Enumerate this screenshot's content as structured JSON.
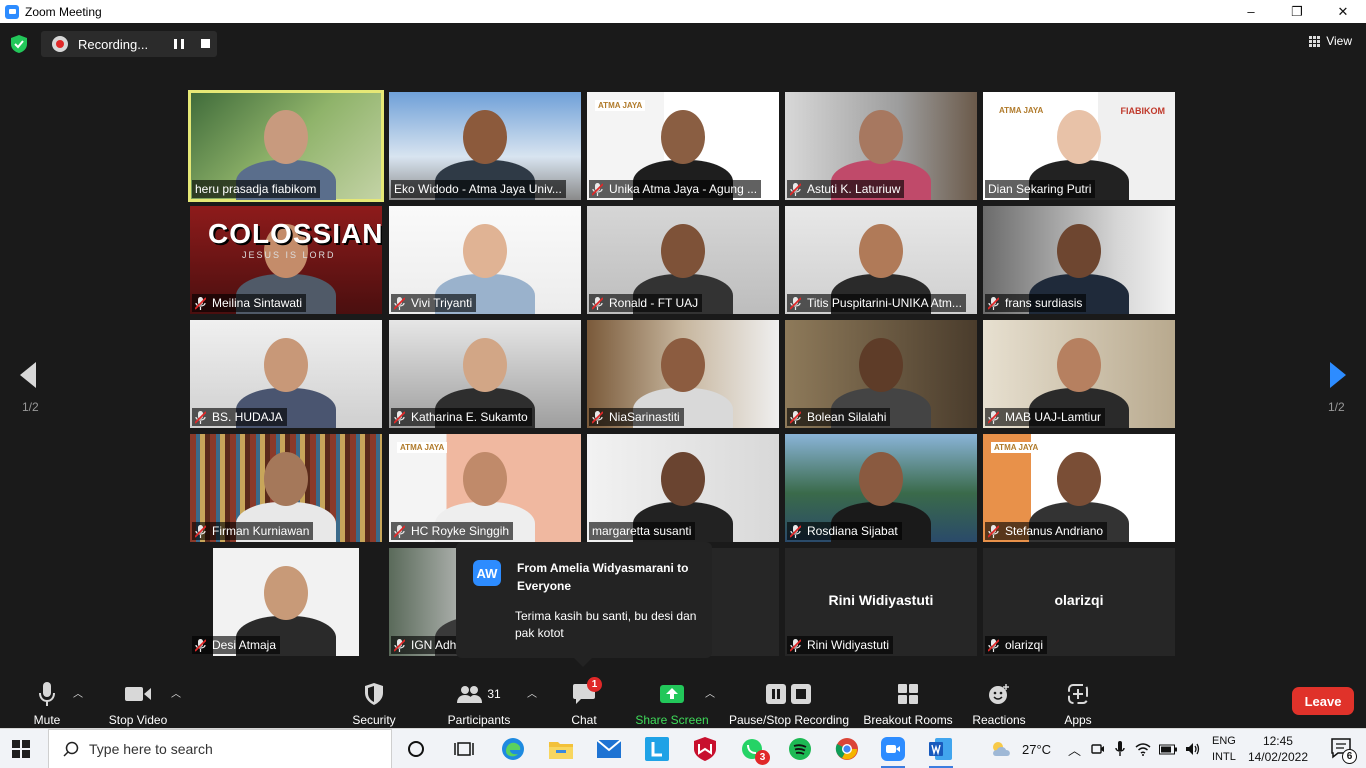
{
  "window": {
    "title": "Zoom Meeting",
    "minimize": "–",
    "maximize": "❐",
    "close": "✕"
  },
  "recording": {
    "label": "Recording..."
  },
  "view": {
    "label": "View"
  },
  "pages": {
    "left": "1/2",
    "right": "1/2"
  },
  "participants": [
    {
      "name": "heru prasadja fiabikom",
      "muted": false,
      "active": true
    },
    {
      "name": "Eko Widodo - Atma Jaya Univ...",
      "muted": false,
      "active": false
    },
    {
      "name": "Unika Atma Jaya - Agung ...",
      "muted": true,
      "active": false
    },
    {
      "name": "Astuti K. Laturiuw",
      "muted": true,
      "active": false
    },
    {
      "name": "Dian Sekaring Putri",
      "muted": false,
      "active": false
    },
    {
      "name": "Meilina Sintawati",
      "muted": true,
      "active": false
    },
    {
      "name": "Vivi Triyanti",
      "muted": true,
      "active": false
    },
    {
      "name": "Ronald - FT UAJ",
      "muted": true,
      "active": false
    },
    {
      "name": "Titis Puspitarini-UNIKA Atm...",
      "muted": true,
      "active": false
    },
    {
      "name": "frans surdiasis",
      "muted": true,
      "active": false
    },
    {
      "name": "BS. HUDAJA",
      "muted": true,
      "active": false
    },
    {
      "name": "Katharina E. Sukamto",
      "muted": true,
      "active": false
    },
    {
      "name": "NiaSarinastiti",
      "muted": true,
      "active": false
    },
    {
      "name": "Bolean Silalahi",
      "muted": true,
      "active": false
    },
    {
      "name": "MAB UAJ-Lamtiur",
      "muted": true,
      "active": false
    },
    {
      "name": "Firman Kurniawan",
      "muted": true,
      "active": false
    },
    {
      "name": "HC Royke Singgih",
      "muted": true,
      "active": false
    },
    {
      "name": "margaretta susanti",
      "muted": false,
      "active": false
    },
    {
      "name": "Rosdiana Sijabat",
      "muted": true,
      "active": false
    },
    {
      "name": "Stefanus Andriano",
      "muted": true,
      "active": false
    },
    {
      "name": "Desi Atmaja",
      "muted": true,
      "active": false
    },
    {
      "name": "IGN Adh",
      "muted": true,
      "active": false
    },
    {
      "name": "",
      "muted": false,
      "active": false
    },
    {
      "name": "Rini Widiyastuti",
      "muted": true,
      "active": false,
      "center": "Rini Widiyastuti"
    },
    {
      "name": "olarizqi",
      "muted": true,
      "active": false,
      "center": "olarizqi"
    }
  ],
  "slide_texts": {
    "coloss": "COLOSSIANS",
    "coloss_sub": "JESUS IS LORD",
    "atma": "ATMA JAYA",
    "fiabikom": "FIABIKOM"
  },
  "chat_popup": {
    "initials": "AW",
    "from": "From Amelia Widyasmarani to Everyone",
    "message": "Terima kasih bu santi, bu desi dan pak kotot"
  },
  "toolbar": {
    "mute": "Mute",
    "stop_video": "Stop Video",
    "security": "Security",
    "participants": "Participants",
    "participants_count": "31",
    "chat": "Chat",
    "chat_badge": "1",
    "share_screen": "Share Screen",
    "pause_stop_recording": "Pause/Stop Recording",
    "breakout_rooms": "Breakout Rooms",
    "reactions": "Reactions",
    "apps": "Apps",
    "leave": "Leave"
  },
  "taskbar": {
    "search_placeholder": "Type here to search",
    "whatsapp_badge": "3",
    "weather": "27°C",
    "lang_top": "ENG",
    "lang_bottom": "INTL",
    "time": "12:45",
    "date": "14/02/2022",
    "notification_count": "6"
  },
  "colors": {
    "accent": "#2d8cff",
    "leave": "#e0322a",
    "share": "#3fdc5a",
    "active_speaker": "#e6e876",
    "record": "#e02828"
  }
}
